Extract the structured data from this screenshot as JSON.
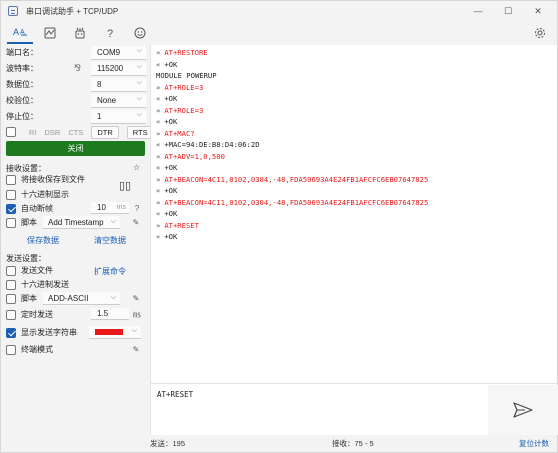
{
  "window": {
    "title": "串口调试助手 + TCP/UDP",
    "minimize": "—",
    "maximize": "☐",
    "close": "✕"
  },
  "toolbar": {
    "tabs": [
      "serial-icon",
      "chart-icon",
      "robot-icon",
      "help-icon",
      "smile-icon"
    ],
    "settings": "gear-icon"
  },
  "serial": {
    "port_label": "端口名：",
    "port_value": "COM9",
    "baud_label": "波特率：",
    "baud_value": "115200",
    "databits_label": "数据位：",
    "databits_value": "8",
    "parity_label": "校验位：",
    "parity_value": "None",
    "stopbits_label": "停止位：",
    "stopbits_value": "1",
    "signals": [
      "RI",
      "DSR",
      "CTS",
      "DTR",
      "RTS"
    ],
    "open_label": "关闭"
  },
  "receive": {
    "title": "接收设置：",
    "save_to_file": "将接收保存到文件",
    "hex_display": "十六进制显示",
    "auto_break": "自动断帧",
    "auto_break_value": "10",
    "auto_break_unit": "ms",
    "help": "?",
    "script_label": "脚本",
    "script_value": "Add Timestamp",
    "save_data": "保存数据",
    "clear_data": "清空数据"
  },
  "send": {
    "title": "发送设置：",
    "send_file": "发送文件",
    "extend_cmd": "扩展命令",
    "hex_send": "十六进制发送",
    "script_label": "脚本",
    "script_value": "ADD-ASCII",
    "timed_send": "定时发送",
    "timed_value": "1.5",
    "show_send_str": "显示发送字符串",
    "show_send_color": "#e81818",
    "terminal_mode": "终端模式",
    "input_text": "AT+RESET"
  },
  "log": [
    {
      "dir": "tx",
      "text": "AT+RESTORE"
    },
    {
      "dir": "rx",
      "text": "+OK"
    },
    {
      "dir": "none",
      "text": "MODULE POWERUP"
    },
    {
      "dir": "tx",
      "text": "AT+ROLE=3"
    },
    {
      "dir": "rx",
      "text": "+OK"
    },
    {
      "dir": "tx",
      "text": "AT+ROLE=3"
    },
    {
      "dir": "rx",
      "text": "+OK"
    },
    {
      "dir": "tx",
      "text": "AT+MAC?"
    },
    {
      "dir": "rx",
      "text": "+MAC=94:DE:B8:D4:06:2D"
    },
    {
      "dir": "tx",
      "text": "AT+ADV=1,0,500"
    },
    {
      "dir": "rx",
      "text": "+OK"
    },
    {
      "dir": "tx",
      "text": "AT+BEACON=4C11,0102,0304,-48,FDA50693A4E24FB1AFCFC6EB07647825"
    },
    {
      "dir": "rx",
      "text": "+OK"
    },
    {
      "dir": "tx",
      "text": "AT+BEACON=4C11,0102,0304,-48,FDA50693A4E24FB1AFCFC6EB07647825"
    },
    {
      "dir": "rx",
      "text": "+OK"
    },
    {
      "dir": "tx",
      "text": "AT+RESET"
    },
    {
      "dir": "rx",
      "text": "+OK"
    }
  ],
  "status": {
    "sent": "发送：195",
    "received": "接收：75 - 5",
    "reset_count": "复位计数"
  }
}
